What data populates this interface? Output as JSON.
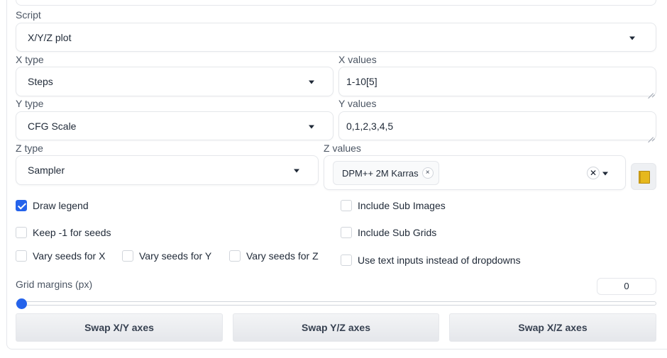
{
  "script": {
    "label": "Script",
    "value": "X/Y/Z plot"
  },
  "x": {
    "type_label": "X type",
    "type_value": "Steps",
    "values_label": "X values",
    "values_value": "1-10[5]"
  },
  "y": {
    "type_label": "Y type",
    "type_value": "CFG Scale",
    "values_label": "Y values",
    "values_value": "0,1,2,3,4,5"
  },
  "z": {
    "type_label": "Z type",
    "type_value": "Sampler",
    "values_label": "Z values",
    "chip": "DPM++ 2M Karras",
    "chip_remove": "×",
    "clear": "✕"
  },
  "checkboxes": {
    "draw_legend": {
      "label": "Draw legend",
      "checked": true
    },
    "include_sub_images": {
      "label": "Include Sub Images",
      "checked": false
    },
    "keep_seeds": {
      "label": "Keep -1 for seeds",
      "checked": false
    },
    "include_sub_grids": {
      "label": "Include Sub Grids",
      "checked": false
    },
    "vary_x": {
      "label": "Vary seeds for X",
      "checked": false
    },
    "vary_y": {
      "label": "Vary seeds for Y",
      "checked": false
    },
    "vary_z": {
      "label": "Vary seeds for Z",
      "checked": false
    },
    "text_inputs": {
      "label": "Use text inputs instead of dropdowns",
      "checked": false
    }
  },
  "grid_margins": {
    "label": "Grid margins (px)",
    "value": "0",
    "fraction": 0
  },
  "buttons": {
    "swap_xy": "Swap X/Y axes",
    "swap_yz": "Swap Y/Z axes",
    "swap_xz": "Swap X/Z axes"
  },
  "colors": {
    "accent": "#2563eb",
    "border": "#e5e7eb",
    "button_bg": "#e5e7eb"
  },
  "icons": {
    "dropdown": "chevron-down-icon",
    "folder": "folder-icon"
  }
}
